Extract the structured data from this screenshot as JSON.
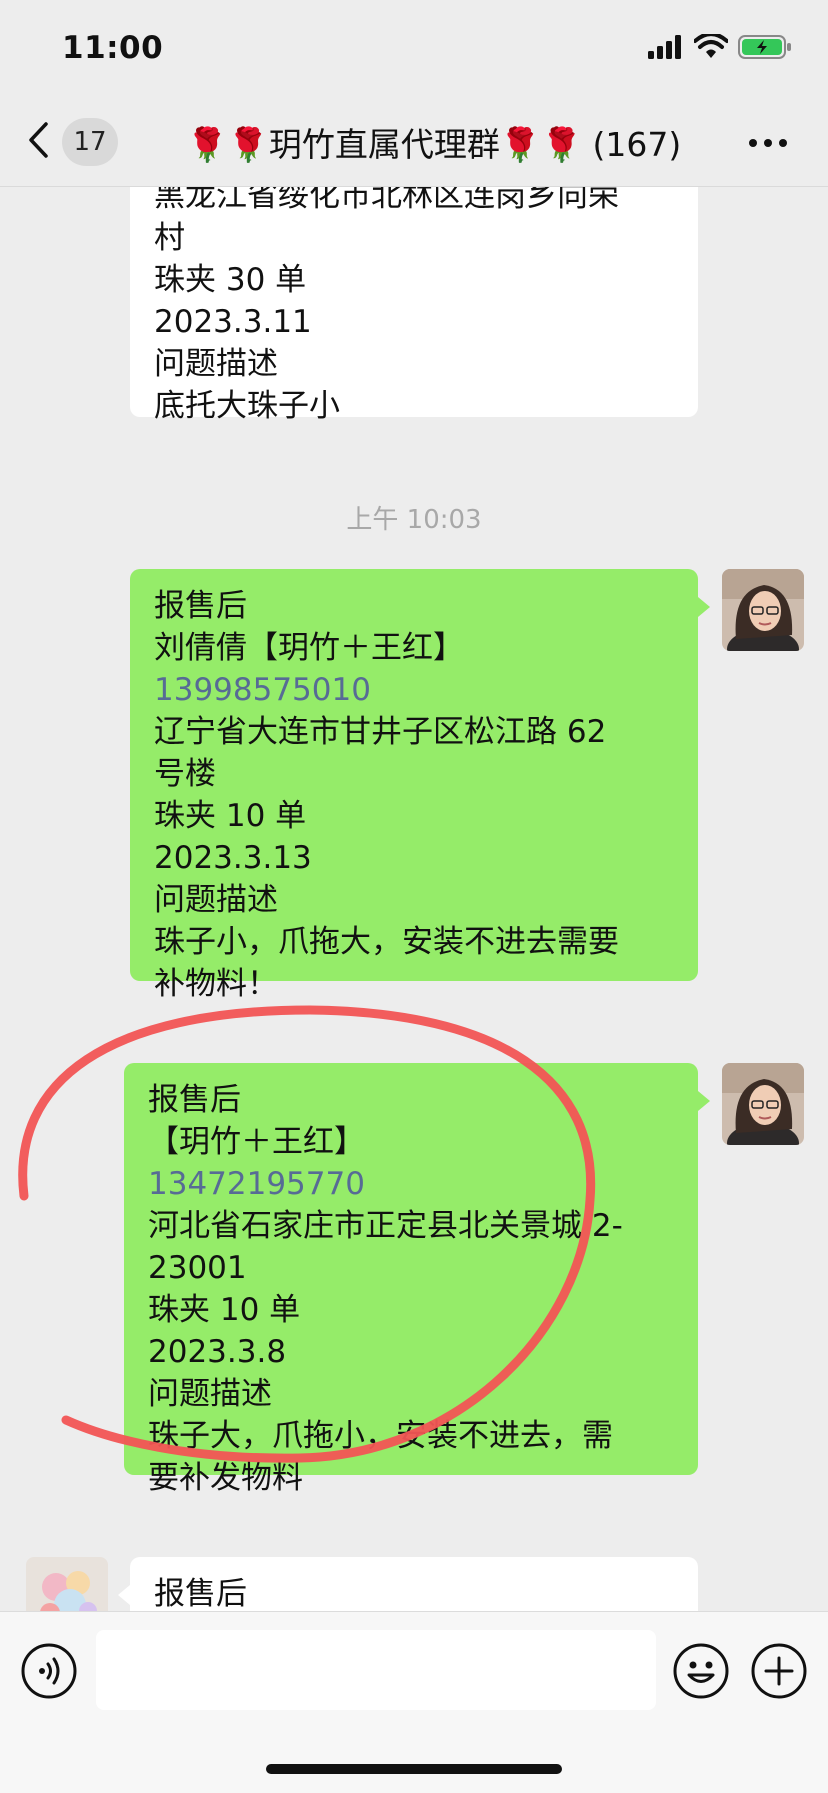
{
  "status": {
    "time": "11:00"
  },
  "nav": {
    "back_count": "17",
    "title": "🌹🌹玥竹直属代理群🌹🌹 (167)"
  },
  "messages": {
    "m1": [
      "黑龙江省绥化市北林区连岗乡向荣",
      "村",
      "珠夹 30 单",
      "2023.3.11",
      "问题描述",
      "底托大珠子小"
    ],
    "timestamp": "上午 10:03",
    "m2": {
      "l0": "报售后",
      "l1": "刘倩倩【玥竹＋王红】",
      "phone": "13998575010",
      "l3": "辽宁省大连市甘井子区松江路 62",
      "l4": "号楼",
      "l5": "珠夹 10 单",
      "l6": "2023.3.13",
      "l7": "问题描述",
      "l8": "珠子小，爪拖大，安装不进去需要",
      "l9": "补物料！"
    },
    "m3": {
      "l0": "报售后",
      "l1": "【玥竹＋王红】",
      "phone": "13472195770",
      "l3": "河北省石家庄市正定县北关景城 2-",
      "l4": "23001",
      "l5": "珠夹 10 单",
      "l6": "2023.3.8",
      "l7": "问题描述",
      "l8": "珠子大，爪拖小，安装不进去，需",
      "l9": "要补发物料"
    },
    "m4": {
      "l0": "报售后"
    }
  },
  "colors": {
    "green_bubble": "#95ec69",
    "white_bubble": "#ffffff",
    "link": "#576b95",
    "annotation": "#f25555"
  }
}
